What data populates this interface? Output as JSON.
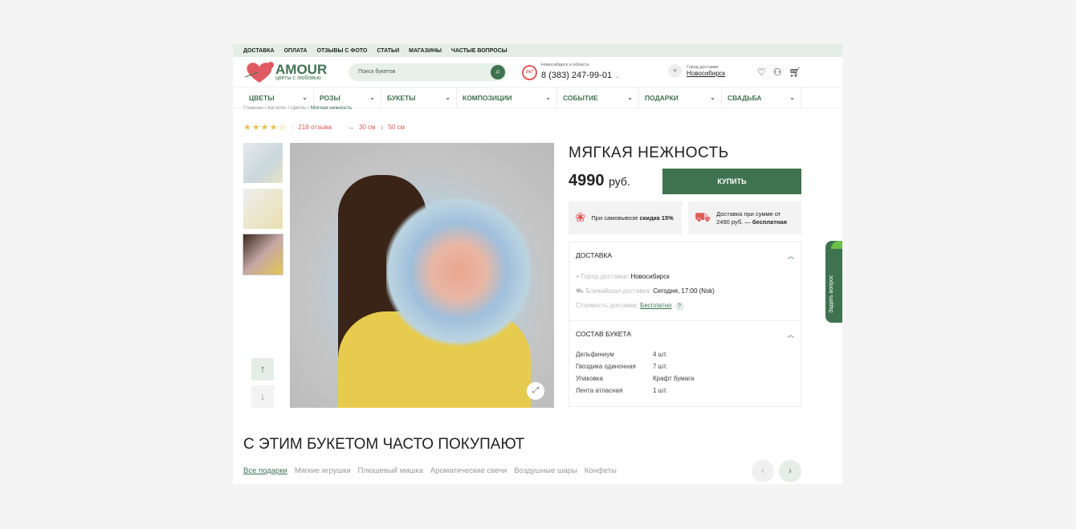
{
  "topbar": [
    "ДОСТАВКА",
    "ОПЛАТА",
    "ОТЗЫВЫ С ФОТО",
    "СТАТЬИ",
    "МАГАЗИНЫ",
    "ЧАСТЫЕ ВОПРОСЫ"
  ],
  "logo": {
    "name": "AMOUR",
    "tagline": "цветы с любовью"
  },
  "search": {
    "placeholder": "Поиск букетов"
  },
  "phone": {
    "region": "Новосибирск и область",
    "number": "8 (383) 247-99-01",
    "badge": "24/7"
  },
  "city": {
    "label": "Город доставки:",
    "value": "Новосибирск"
  },
  "nav": [
    "ЦВЕТЫ",
    "РОЗЫ",
    "БУКЕТЫ",
    "КОМПОЗИЦИИ",
    "СОБЫТИЕ",
    "ПОДАРКИ",
    "СВАДЬБА"
  ],
  "breadcrumb": [
    "Главная",
    "Каталог",
    "Цветы",
    "Мягкая нежность"
  ],
  "rating": {
    "stars": 4.5,
    "reviews": "218 отзыва",
    "width": "30 см",
    "height": "50 см"
  },
  "product": {
    "title": "МЯГКАЯ НЕЖНОСТЬ",
    "price": "4990",
    "currency": "руб.",
    "buy": "КУПИТЬ"
  },
  "cards": [
    {
      "pre": "При самовывозе ",
      "bold": "скидка 15%"
    },
    {
      "pre": "Доставка при сумме от 2490 руб. — ",
      "bold": "бесплатная"
    }
  ],
  "delivery": {
    "title": "ДОСТАВКА",
    "city_label": "Город доставки:",
    "city": "Новосибирск",
    "nearest_label": "Ближайшая доставка:",
    "nearest": "Сегодня, 17:00 (Nsk)",
    "cost_label": "Стоимость доставки:",
    "cost": "Бесплатно",
    "help": "?"
  },
  "composition": {
    "title": "СОСТАВ БУКЕТА",
    "items": [
      [
        "Дельфиниум",
        "4 шт."
      ],
      [
        "Гвоздика одиночная",
        "7 шт."
      ],
      [
        "Упаковка",
        "Крафт бумага"
      ],
      [
        "Лента атласная",
        "1 шт."
      ]
    ]
  },
  "related": {
    "title": "С ЭТИМ БУКЕТОМ ЧАСТО ПОКУПАЮТ",
    "tabs": [
      "Все подарки",
      "Мягкие игрушки",
      "Плюшевый мишка",
      "Ароматические свечи",
      "Воздушные шары",
      "Конфеты"
    ]
  },
  "side_button": "Задать вопрос"
}
